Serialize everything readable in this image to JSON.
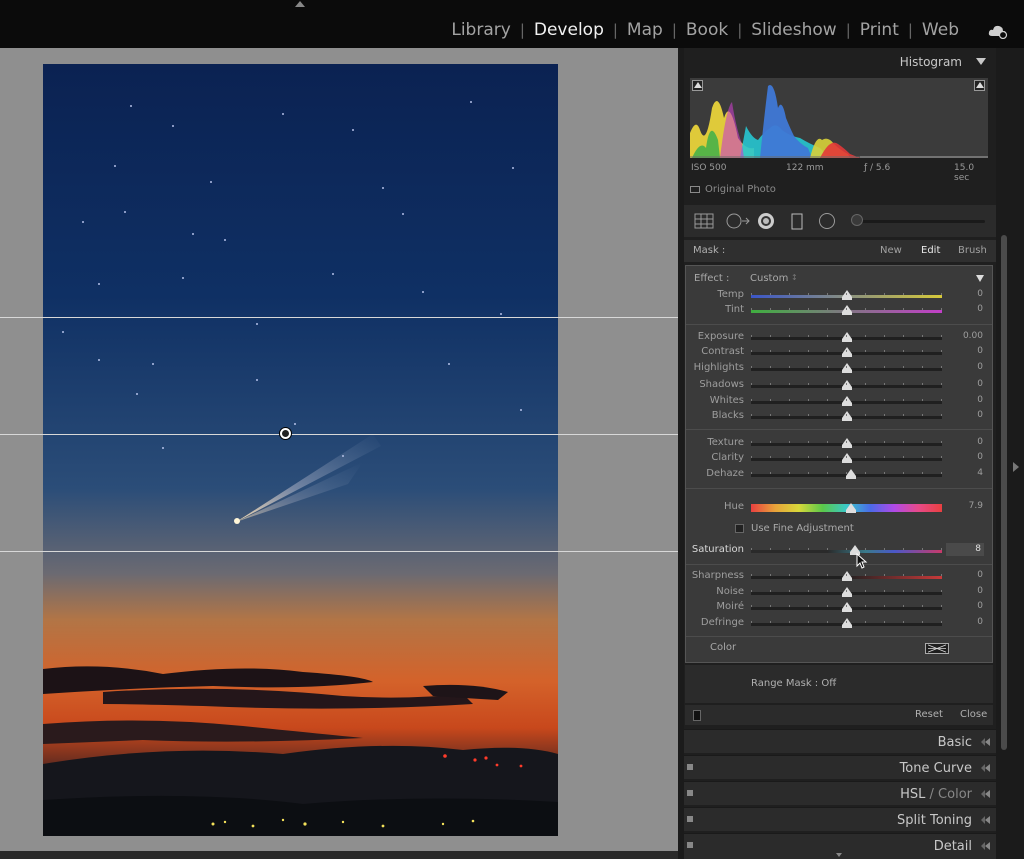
{
  "modules": [
    "Library",
    "Develop",
    "Map",
    "Book",
    "Slideshow",
    "Print",
    "Web"
  ],
  "active_module": "Develop",
  "histogram": {
    "title": "Histogram",
    "iso": "ISO 500",
    "focal": "122 mm",
    "aperture": "ƒ / 5.6",
    "shutter": "15.0 sec",
    "original_photo": "Original Photo"
  },
  "mask": {
    "label": "Mask :",
    "new": "New",
    "edit": "Edit",
    "brush": "Brush"
  },
  "effect": {
    "label": "Effect :",
    "value": "Custom",
    "updown": "↕"
  },
  "sliders": {
    "temp": {
      "label": "Temp",
      "value": "0"
    },
    "tint": {
      "label": "Tint",
      "value": "0"
    },
    "exposure": {
      "label": "Exposure",
      "value": "0.00"
    },
    "contrast": {
      "label": "Contrast",
      "value": "0"
    },
    "highlights": {
      "label": "Highlights",
      "value": "0"
    },
    "shadows": {
      "label": "Shadows",
      "value": "0"
    },
    "whites": {
      "label": "Whites",
      "value": "0"
    },
    "blacks": {
      "label": "Blacks",
      "value": "0"
    },
    "texture": {
      "label": "Texture",
      "value": "0"
    },
    "clarity": {
      "label": "Clarity",
      "value": "0"
    },
    "dehaze": {
      "label": "Dehaze",
      "value": "4"
    },
    "hue": {
      "label": "Hue",
      "value": "7.9"
    },
    "saturation": {
      "label": "Saturation",
      "value": "8"
    },
    "sharpness": {
      "label": "Sharpness",
      "value": "0"
    },
    "noise": {
      "label": "Noise",
      "value": "0"
    },
    "moire": {
      "label": "Moiré",
      "value": "0"
    },
    "defringe": {
      "label": "Defringe",
      "value": "0"
    }
  },
  "fine_adjustment": "Use Fine Adjustment",
  "color_label": "Color",
  "range_mask": {
    "label": "Range Mask : Off",
    "updown": "↕"
  },
  "reset": "Reset",
  "close": "Close",
  "sections": {
    "basic": "Basic",
    "tone_curve": "Tone Curve",
    "hsl_a": "HSL",
    "hsl_sep": " / ",
    "hsl_b": "Color",
    "split_toning": "Split Toning",
    "detail": "Detail"
  },
  "colors": {
    "accent_active": "#f2f2f2",
    "panel_bg": "#3a3a3a",
    "canvas_bg": "#8f8f8f",
    "sky_top": "#0d2a5c",
    "sunset_orange": "#e8591a"
  },
  "icons": [
    "cloud-sync-icon",
    "grid-overlay-icon",
    "circle-arrow-icon",
    "radial-ring-icon",
    "rect-brush-icon",
    "circle-icon",
    "chevron-triangle-icon",
    "cursor-icon"
  ]
}
